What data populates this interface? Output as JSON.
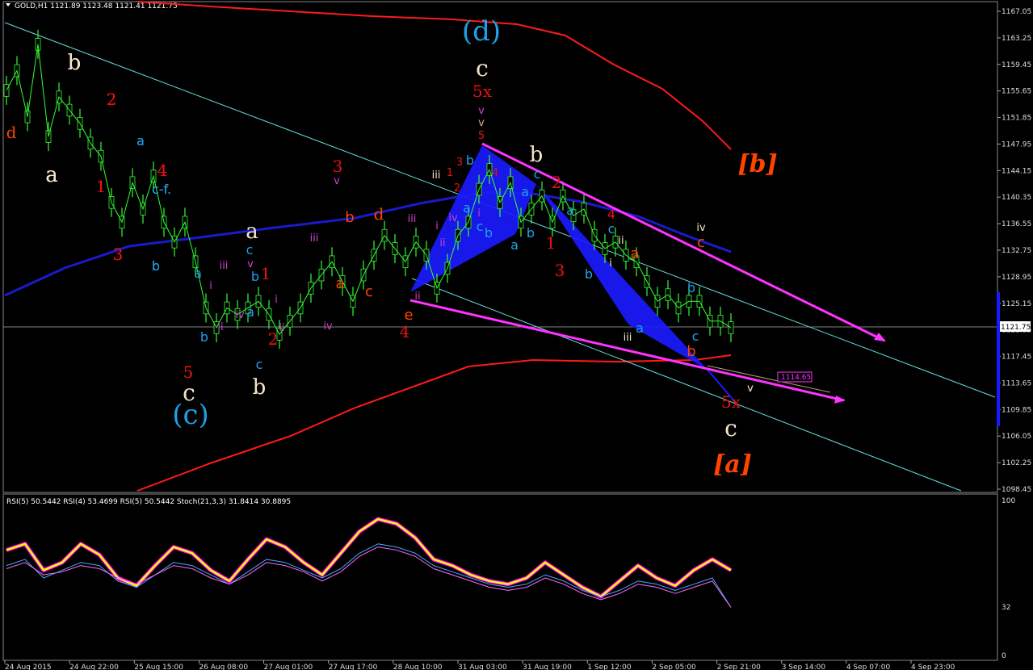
{
  "header": {
    "main": "GOLD,H1  1121.89 1123.48 1121.41 1121.75",
    "sub": "RSI(5) 50.5442  RSI(4) 53.4699  RSI(5) 50.5442  Stoch(21,3,3) 31.8414 30.8895"
  },
  "price_axis": {
    "ticks": [
      "1167.05",
      "1163.25",
      "1159.45",
      "1155.65",
      "1151.85",
      "1147.95",
      "1144.15",
      "1140.35",
      "1136.55",
      "1132.75",
      "1128.95",
      "1125.15",
      "1121.35",
      "1117.45",
      "1113.65",
      "1109.85",
      "1106.05",
      "1102.25",
      "1098.45"
    ],
    "current": "1121.75",
    "level": "1114.65"
  },
  "sub_axis": {
    "ticks": [
      "100",
      "32",
      "0"
    ]
  },
  "time_axis": [
    "24 Aug 2015",
    "24 Aug 22:00",
    "25 Aug 15:00",
    "26 Aug 08:00",
    "27 Aug 01:00",
    "27 Aug 17:00",
    "28 Aug 10:00",
    "31 Aug 03:00",
    "31 Aug 19:00",
    "1 Sep 12:00",
    "2 Sep 05:00",
    "2 Sep 21:00",
    "3 Sep 14:00",
    "4 Sep 07:00",
    "4 Sep 23:00"
  ],
  "colors": {
    "candle": "#33ff33",
    "envelope": "#ff1a1a",
    "ma": "#1a1acc",
    "trend": "#ff33ff",
    "channel": "#66dddd",
    "pattern": "#1a1aff",
    "rsi_fast": "#ff00ff",
    "rsi_main": "#ffff00",
    "stoch_main": "#44aaff",
    "stoch_signal": "#ff66ff"
  },
  "wave_labels": [
    {
      "text": "(d)",
      "color": "#1ea0e8",
      "size": 34
    },
    {
      "text": "c",
      "color": "#f5e6c8",
      "size": 28
    },
    {
      "text": "5x",
      "color": "#e11",
      "size": 20
    },
    {
      "text": "v",
      "color": "#d040d0",
      "size": 13
    },
    {
      "text": "v",
      "color": "#e8a0a0",
      "size": 13
    },
    {
      "text": "5",
      "color": "#e11",
      "size": 13
    },
    {
      "text": "b",
      "color": "#f5e6c8",
      "size": 26
    },
    {
      "text": "[b]",
      "color": "#ff4400",
      "size": 30
    },
    {
      "text": "d",
      "color": "#ff4400",
      "size": 20
    },
    {
      "text": "b",
      "color": "#f5e6c8",
      "size": 26
    },
    {
      "text": "a",
      "color": "#f5e6c8",
      "size": 26
    },
    {
      "text": "2",
      "color": "#e11",
      "size": 20
    },
    {
      "text": "a",
      "color": "#1ea0e8",
      "size": 16
    },
    {
      "text": "4",
      "color": "#e11",
      "size": 20
    },
    {
      "text": "c-f.",
      "color": "#1ea0e8",
      "size": 16
    },
    {
      "text": "1",
      "color": "#e11",
      "size": 20
    },
    {
      "text": "3",
      "color": "#e11",
      "size": 20
    },
    {
      "text": "b",
      "color": "#1ea0e8",
      "size": 16
    },
    {
      "text": "a",
      "color": "#f5e6c8",
      "size": 26
    },
    {
      "text": "c",
      "color": "#1ea0e8",
      "size": 16
    },
    {
      "text": "v",
      "color": "#d040d0",
      "size": 13
    },
    {
      "text": "b",
      "color": "#1ea0e8",
      "size": 16
    },
    {
      "text": "1",
      "color": "#e11",
      "size": 20
    },
    {
      "text": "iii",
      "color": "#d040d0",
      "size": 13
    },
    {
      "text": "a",
      "color": "#1ea0e8",
      "size": 16
    },
    {
      "text": "i",
      "color": "#d040d0",
      "size": 13
    },
    {
      "text": "iv",
      "color": "#d040d0",
      "size": 13
    },
    {
      "text": "a",
      "color": "#1ea0e8",
      "size": 16
    },
    {
      "text": "i",
      "color": "#d040d0",
      "size": 13
    },
    {
      "text": "ii",
      "color": "#d040d0",
      "size": 13
    },
    {
      "text": "b",
      "color": "#1ea0e8",
      "size": 16
    },
    {
      "text": "ii",
      "color": "#d040d0",
      "size": 13
    },
    {
      "text": "c",
      "color": "#1ea0e8",
      "size": 16
    },
    {
      "text": "2",
      "color": "#e11",
      "size": 20
    },
    {
      "text": "5",
      "color": "#e11",
      "size": 20
    },
    {
      "text": "c",
      "color": "#f5e6c8",
      "size": 28
    },
    {
      "text": "(c)",
      "color": "#1ea0e8",
      "size": 34
    },
    {
      "text": "b",
      "color": "#f5e6c8",
      "size": 26
    },
    {
      "text": "3",
      "color": "#e11",
      "size": 20
    },
    {
      "text": "v",
      "color": "#d040d0",
      "size": 13
    },
    {
      "text": "iii",
      "color": "#d040d0",
      "size": 13
    },
    {
      "text": "b",
      "color": "#ff4400",
      "size": 18
    },
    {
      "text": "a",
      "color": "#ff4400",
      "size": 18
    },
    {
      "text": "iv",
      "color": "#d040d0",
      "size": 13
    },
    {
      "text": "c",
      "color": "#ff4400",
      "size": 18
    },
    {
      "text": "iii",
      "color": "#d040d0",
      "size": 13
    },
    {
      "text": "i",
      "color": "#d040d0",
      "size": 13
    },
    {
      "text": "ii",
      "color": "#d040d0",
      "size": 13
    },
    {
      "text": "ii",
      "color": "#d040d0",
      "size": 13
    },
    {
      "text": "e",
      "color": "#ff4400",
      "size": 18
    },
    {
      "text": "4",
      "color": "#e11",
      "size": 20
    },
    {
      "text": "iii",
      "color": "#f5e6c8",
      "size": 13
    },
    {
      "text": "1",
      "color": "#e11",
      "size": 13
    },
    {
      "text": "3",
      "color": "#e11",
      "size": 13
    },
    {
      "text": "b",
      "color": "#1ea0e8",
      "size": 16
    },
    {
      "text": "iv",
      "color": "#d040d0",
      "size": 13
    },
    {
      "text": "2",
      "color": "#e11",
      "size": 13
    },
    {
      "text": "a",
      "color": "#1ea0e8",
      "size": 16
    },
    {
      "text": "i",
      "color": "#d040d0",
      "size": 13
    },
    {
      "text": "c",
      "color": "#1ea0e8",
      "size": 16
    },
    {
      "text": "4",
      "color": "#e11",
      "size": 13
    },
    {
      "text": "b",
      "color": "#1ea0e8",
      "size": 16
    },
    {
      "text": "a",
      "color": "#1ea0e8",
      "size": 16
    },
    {
      "text": "c",
      "color": "#1ea0e8",
      "size": 16
    },
    {
      "text": "2",
      "color": "#e11",
      "size": 20
    },
    {
      "text": "a",
      "color": "#1ea0e8",
      "size": 16
    },
    {
      "text": "a",
      "color": "#1ea0e8",
      "size": 16
    },
    {
      "text": "b",
      "color": "#1ea0e8",
      "size": 16
    },
    {
      "text": "1",
      "color": "#e11",
      "size": 20
    },
    {
      "text": "3",
      "color": "#e11",
      "size": 20
    },
    {
      "text": "b",
      "color": "#1ea0e8",
      "size": 16
    },
    {
      "text": "4",
      "color": "#e11",
      "size": 16
    },
    {
      "text": "c",
      "color": "#1ea0e8",
      "size": 16
    },
    {
      "text": "ii",
      "color": "#f5e6c8",
      "size": 13
    },
    {
      "text": "a",
      "color": "#ff4400",
      "size": 18
    },
    {
      "text": "i",
      "color": "#f5e6c8",
      "size": 13
    },
    {
      "text": "iii",
      "color": "#f5e6c8",
      "size": 13
    },
    {
      "text": "a",
      "color": "#1ea0e8",
      "size": 16
    },
    {
      "text": "iv",
      "color": "#f5e6c8",
      "size": 13
    },
    {
      "text": "c",
      "color": "#ff4400",
      "size": 18
    },
    {
      "text": "b",
      "color": "#1ea0e8",
      "size": 16
    },
    {
      "text": "c",
      "color": "#1ea0e8",
      "size": 16
    },
    {
      "text": "b",
      "color": "#ff4400",
      "size": 18
    },
    {
      "text": "5x",
      "color": "#e11",
      "size": 20
    },
    {
      "text": "c",
      "color": "#f5e6c8",
      "size": 28
    },
    {
      "text": "[a]",
      "color": "#ff4400",
      "size": 30
    },
    {
      "text": "v",
      "color": "#f5e6c8",
      "size": 13
    },
    {
      "text": "d",
      "color": "#ff4400",
      "size": 20
    },
    {
      "text": "a",
      "color": "#f5e6c8",
      "size": 26
    },
    {
      "text": "b",
      "color": "#f5e6c8",
      "size": 26
    },
    {
      "text": "2",
      "color": "#e11",
      "size": 20
    },
    {
      "text": "1",
      "color": "#e11",
      "size": 20
    },
    {
      "text": "3",
      "color": "#e11",
      "size": 20
    },
    {
      "text": "4",
      "color": "#e11",
      "size": 20
    },
    {
      "text": "a",
      "color": "#1ea0e8",
      "size": 16
    },
    {
      "text": "b",
      "color": "#1ea0e8",
      "size": 16
    },
    {
      "text": "c-f.",
      "color": "#1ea0e8",
      "size": 16
    }
  ],
  "chart_data": {
    "type": "line",
    "instrument": "GOLD",
    "timeframe": "H1",
    "ohlc_last": {
      "open": 1121.89,
      "high": 1123.48,
      "low": 1121.41,
      "close": 1121.75
    },
    "ylim": [
      1096.5,
      1169.0
    ],
    "series": [
      {
        "values": [
          1157,
          1160,
          1153,
          1164,
          1150,
          1156,
          1154,
          1152,
          1149,
          1147,
          1140,
          1137,
          1143,
          1139,
          1144,
          1137,
          1134,
          1137,
          1131,
          1124,
          1121,
          1124,
          1123,
          1124,
          1125,
          1123,
          1120,
          1122,
          1124,
          1127,
          1129,
          1131,
          1128,
          1125,
          1129,
          1132,
          1135,
          1133,
          1131,
          1134,
          1132,
          1127,
          1130,
          1135,
          1137,
          1142,
          1145,
          1140,
          1143,
          1137,
          1139,
          1141,
          1137,
          1141,
          1138,
          1139,
          1135,
          1133,
          1134,
          1132,
          1131,
          1128,
          1125,
          1126,
          1124,
          1125,
          1125,
          1122,
          1122,
          1121
        ]
      },
      {
        "values": [
          1153,
          1140,
          1125,
          1122,
          1124,
          1130,
          1145,
          1140,
          1136,
          1128
        ]
      },
      {
        "values": [
          1131,
          1134,
          1136,
          1138,
          1140,
          1139,
          1137,
          1135,
          1133
        ]
      },
      {
        "values": [
          68,
          72,
          55,
          60,
          72,
          65,
          50,
          45,
          58,
          70,
          66,
          55,
          48,
          62,
          75,
          70,
          60,
          52,
          66,
          80,
          88,
          85,
          76,
          62,
          58,
          52,
          48,
          46,
          50,
          60,
          52,
          44,
          38,
          48,
          58,
          50,
          45,
          55,
          62,
          55
        ]
      },
      {
        "values": [
          58,
          62,
          50,
          55,
          60,
          58,
          48,
          44,
          52,
          60,
          58,
          52,
          46,
          54,
          62,
          60,
          55,
          50,
          56,
          66,
          72,
          70,
          66,
          58,
          54,
          50,
          46,
          44,
          46,
          52,
          48,
          42,
          38,
          42,
          48,
          46,
          42,
          46,
          50,
          31
        ]
      },
      {
        "values": [
          56,
          60,
          52,
          54,
          58,
          56,
          50,
          46,
          52,
          58,
          56,
          50,
          46,
          52,
          60,
          58,
          54,
          48,
          54,
          64,
          70,
          68,
          64,
          56,
          52,
          48,
          44,
          42,
          44,
          50,
          46,
          40,
          36,
          40,
          46,
          44,
          40,
          44,
          48,
          31
        ]
      }
    ]
  }
}
